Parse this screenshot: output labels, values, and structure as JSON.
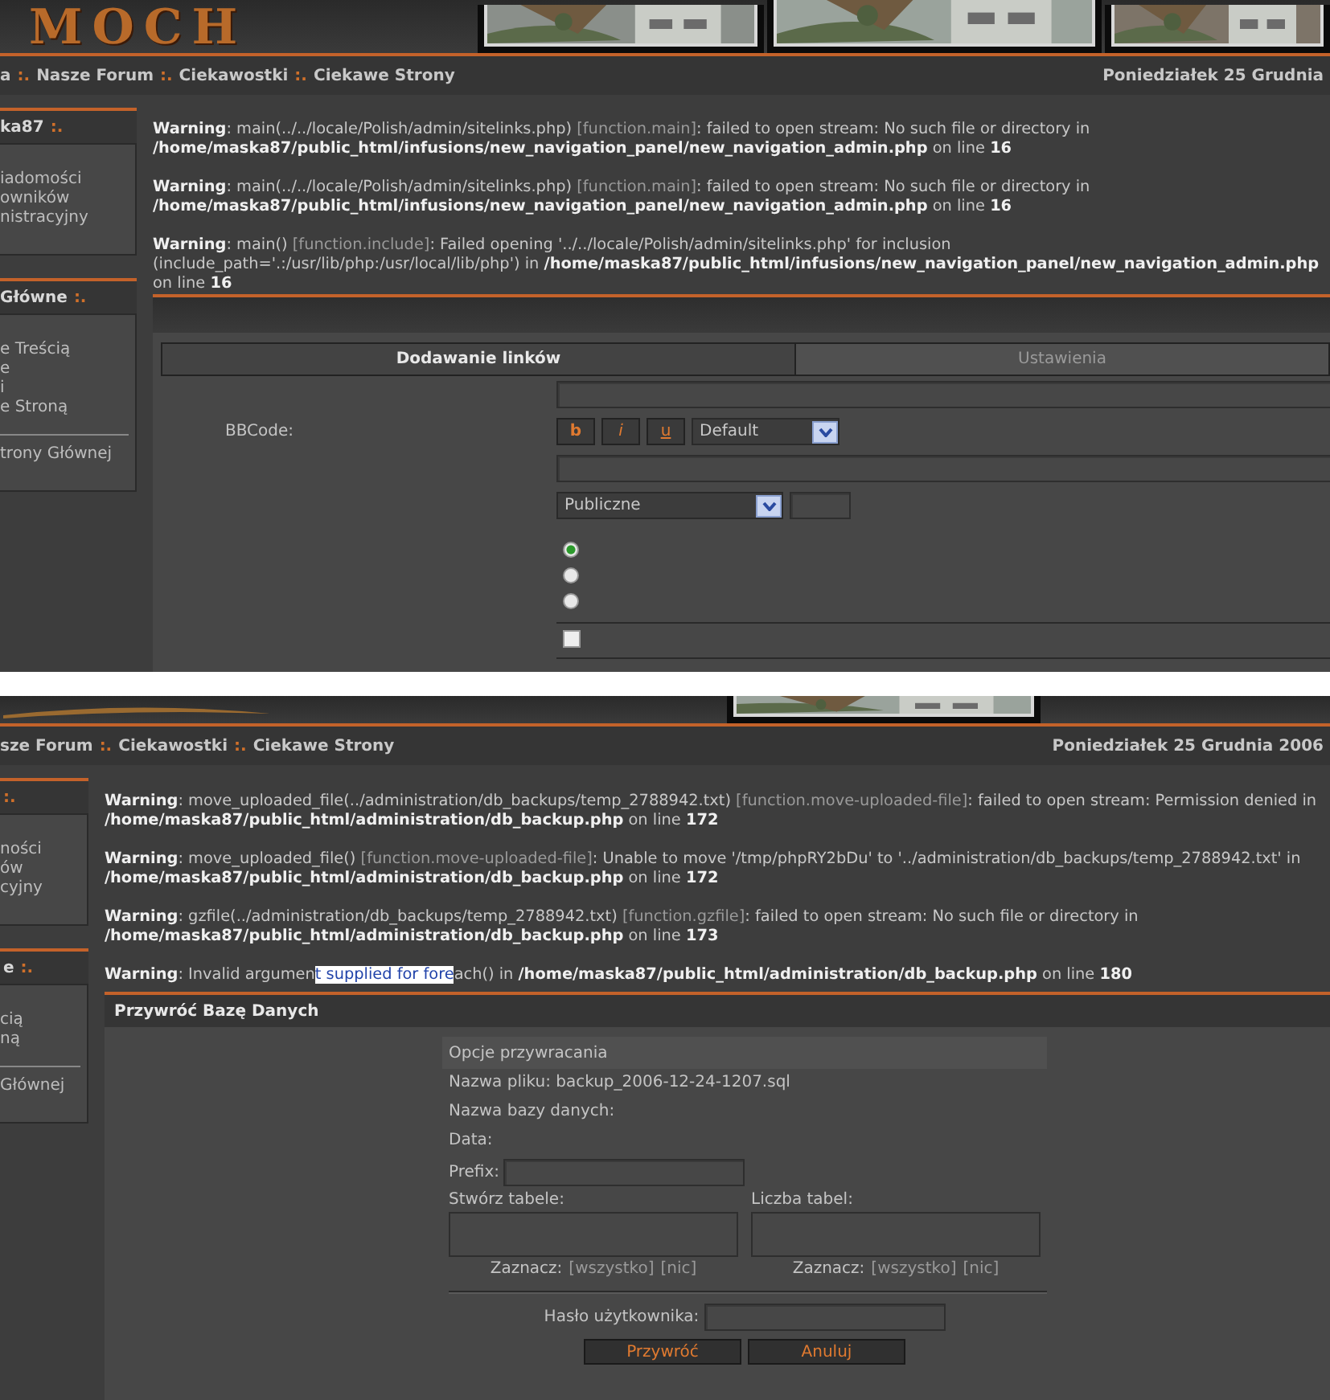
{
  "screens": [
    {
      "header": {
        "logo": "MOCH",
        "pictures": [
          {
            "kind": "picture"
          },
          {
            "kind": "picture"
          },
          {
            "kind": "picture"
          }
        ]
      },
      "breadcrumb": [
        {
          "kind": "link",
          "text": "a"
        },
        {
          "kind": "separator",
          "text": ":."
        },
        {
          "kind": "link",
          "text": "Nasze Forum"
        },
        {
          "kind": "separator",
          "text": ":."
        },
        {
          "kind": "link",
          "text": "Ciekawostki"
        },
        {
          "kind": "separator",
          "text": ":."
        },
        {
          "kind": "link",
          "text": "Ciekawe Strony"
        }
      ],
      "date": "Poniedziałek 25 Grudnia",
      "sidebar": [
        {
          "title": "ka87",
          "mark": ":.",
          "items": [
            "iadomości",
            "owników",
            "nistracyjny"
          ]
        },
        {
          "title": "Główne",
          "mark": ":.",
          "items": [
            "e Treścią",
            "e",
            "i",
            "e Stroną"
          ],
          "footer_item": "trony Głównej"
        }
      ],
      "warnings": [
        {
          "segments": [
            {
              "kind": "plain",
              "text": "**Warning**: main(../../locale/Polish/admin/sitelinks.php) "
            },
            {
              "kind": "link",
              "text": "[function.main]"
            },
            {
              "kind": "plain",
              "text": ": failed to open stream: No such file or directory in **/home/maska87/public_html/infusions/new_navigation_panel/new_navigation_admin.php** on line **16**"
            }
          ]
        },
        {
          "segments": [
            {
              "kind": "plain",
              "text": "**Warning**: main(../../locale/Polish/admin/sitelinks.php) "
            },
            {
              "kind": "link",
              "text": "[function.main]"
            },
            {
              "kind": "plain",
              "text": ": failed to open stream: No such file or directory in **/home/maska87/public_html/infusions/new_navigation_panel/new_navigation_admin.php** on line **16**"
            }
          ]
        },
        {
          "segments": [
            {
              "kind": "plain",
              "text": "**Warning**: main() "
            },
            {
              "kind": "link",
              "text": "[function.include]"
            },
            {
              "kind": "plain",
              "text": ": Failed opening '../../locale/Polish/admin/sitelinks.php' for inclusion (include_path='.:/usr/lib/php:/usr/local/lib/php') in **/home/maska87/public_html/infusions/new_navigation_panel/new_navigation_admin.php** on line **16**"
            }
          ]
        }
      ],
      "content": {
        "kind": "link_form",
        "tabs": [
          {
            "label": "Dodawanie linków",
            "selected": true
          },
          {
            "label": "Ustawienia",
            "selected": false
          }
        ],
        "bbcode_label": "BBCode:",
        "format_buttons": [
          "b",
          "i",
          "u"
        ],
        "font_select": "Default",
        "visibility_select": "Publiczne",
        "radios": [
          {
            "selected": true
          },
          {
            "selected": false
          },
          {
            "selected": false
          }
        ],
        "checkbox": {
          "checked": false
        }
      }
    },
    {
      "header": {
        "pictures": [
          {
            "kind": "picture"
          }
        ]
      },
      "breadcrumb": [
        {
          "kind": "link",
          "text": "sze Forum"
        },
        {
          "kind": "separator",
          "text": ":."
        },
        {
          "kind": "link",
          "text": "Ciekawostki"
        },
        {
          "kind": "separator",
          "text": ":."
        },
        {
          "kind": "link",
          "text": "Ciekawe Strony"
        }
      ],
      "date": "Poniedziałek 25 Grudnia 2006",
      "sidebar": [
        {
          "mark": ":.",
          "items": [
            "ności",
            "ów",
            "cyjny"
          ]
        },
        {
          "title": "e",
          "mark": ":.",
          "items": [
            "cią",
            "ną"
          ],
          "footer_item": "Głównej"
        }
      ],
      "warnings": [
        {
          "segments": [
            {
              "kind": "plain",
              "text": "**Warning**: move_uploaded_file(../administration/db_backups/temp_2788942.txt) "
            },
            {
              "kind": "link",
              "text": "[function.move-uploaded-file]"
            },
            {
              "kind": "plain",
              "text": ": failed to open stream: Permission denied in **/home/maska87/public_html/administration/db_backup.php** on line **172**"
            }
          ]
        },
        {
          "segments": [
            {
              "kind": "plain",
              "text": "**Warning**: move_uploaded_file() "
            },
            {
              "kind": "link",
              "text": "[function.move-uploaded-file]"
            },
            {
              "kind": "plain",
              "text": ": Unable to move '/tmp/phpRY2bDu' to '../administration/db_backups/temp_2788942.txt' in **/home/maska87/public_html/administration/db_backup.php** on line **172**"
            }
          ]
        },
        {
          "segments": [
            {
              "kind": "plain",
              "text": "**Warning**: gzfile(../administration/db_backups/temp_2788942.txt) "
            },
            {
              "kind": "link",
              "text": "[function.gzfile]"
            },
            {
              "kind": "plain",
              "text": ": failed to open stream: No such file or directory in **/home/maska87/public_html/administration/db_backup.php** on line **173**"
            }
          ]
        },
        {
          "segments": [
            {
              "kind": "plain",
              "text": "**Warning**: Invalid argumen"
            },
            {
              "kind": "highlight",
              "text": "t supplied for fore"
            },
            {
              "kind": "plain",
              "text": "ach() in **/home/maska87/public_html/administration/db_backup.php** on line **180**"
            }
          ]
        }
      ],
      "content": {
        "kind": "restore_form",
        "title": "Przywróć Bazę Danych",
        "options_title": "Opcje przywracania",
        "info": [
          "Nazwa pliku: backup_2006-12-24-1207.sql",
          "Nazwa bazy danych:",
          "Data:"
        ],
        "prefix_label": "Prefix:",
        "lists": [
          {
            "label": "Stwórz tabele:",
            "select_label": "Zaznacz:",
            "all": "[wszystko]",
            "none": "[nic]"
          },
          {
            "label": "Liczba tabel:",
            "select_label": "Zaznacz:",
            "all": "[wszystko]",
            "none": "[nic]"
          }
        ],
        "password_label": "Hasło użytkownika:",
        "buttons": [
          "Przywróć",
          "Anuluj"
        ]
      }
    }
  ]
}
